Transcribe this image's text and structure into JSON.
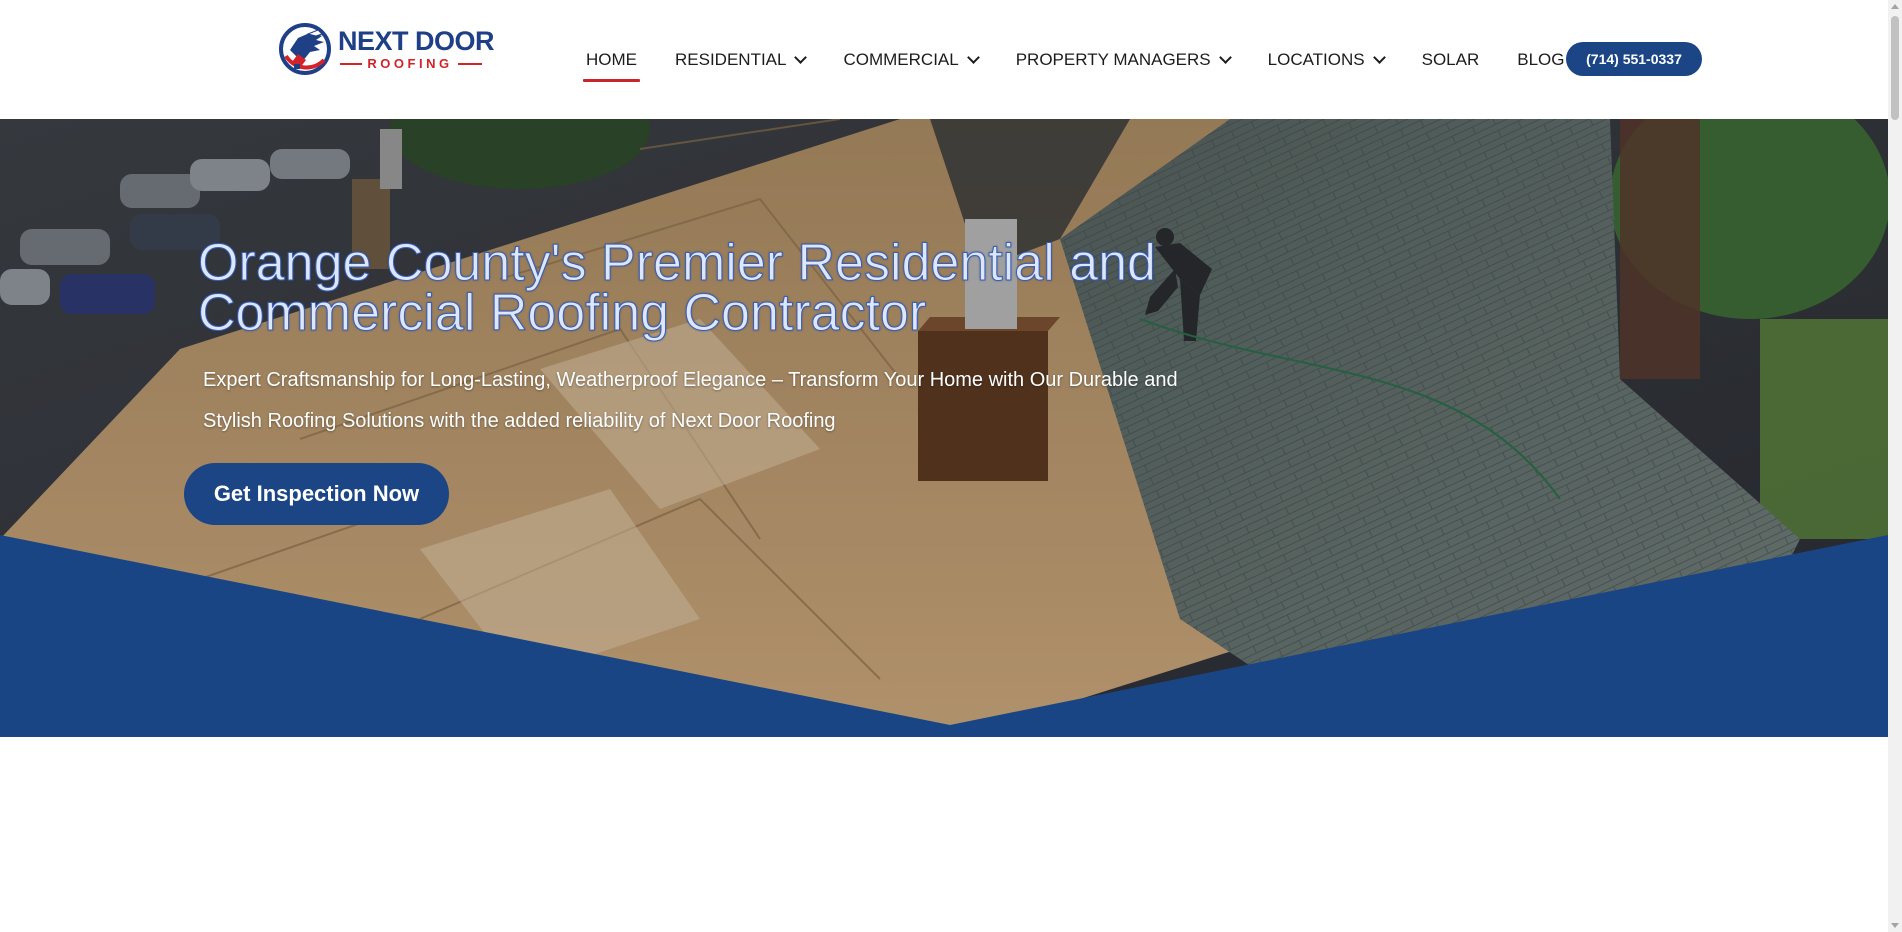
{
  "brand": {
    "name": "NEXT DOOR",
    "tagline": "ROOFING",
    "navy": "#1f3f86",
    "red": "#d2232a"
  },
  "nav": {
    "items": [
      {
        "label": "HOME",
        "active": true,
        "dropdown": false
      },
      {
        "label": "RESIDENTIAL",
        "active": false,
        "dropdown": true
      },
      {
        "label": "COMMERCIAL",
        "active": false,
        "dropdown": true
      },
      {
        "label": "PROPERTY MANAGERS",
        "active": false,
        "dropdown": true
      },
      {
        "label": "LOCATIONS",
        "active": false,
        "dropdown": true
      },
      {
        "label": "SOLAR",
        "active": false,
        "dropdown": false
      },
      {
        "label": "BLOG",
        "active": false,
        "dropdown": false
      }
    ],
    "phone": "(714) 551-0337",
    "chevron_icon": "chevron-down-icon"
  },
  "hero": {
    "title": "Orange County's Premier Residential and Commercial Roofing Contractor",
    "subtitle": "Expert Craftsmanship for Long-Lasting, Weatherproof Elegance – Transform Your Home with Our Durable and Stylish Roofing Solutions with the added reliability of Next Door Roofing",
    "cta_label": "Get Inspection Now",
    "band_color": "#1a4584",
    "button_color": "#1b4585"
  }
}
